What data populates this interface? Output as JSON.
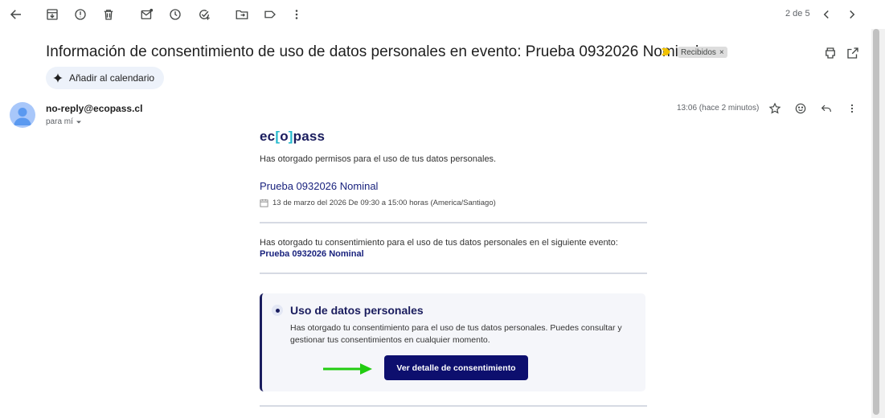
{
  "toolbar": {
    "icons": [
      "back-arrow-icon",
      "archive-icon",
      "report-spam-icon",
      "delete-icon",
      "mark-unread-icon",
      "snooze-icon",
      "add-task-icon",
      "move-to-icon",
      "label-icon",
      "more-vert-icon"
    ],
    "pager_text": "2 de 5"
  },
  "subject": "Información de consentimiento de uso de datos personales en evento: Prueba 0932026 Nominal",
  "label_chip": "Recibidos",
  "label_chip_close": "×",
  "calendar_button": "Añadir al calendario",
  "sender": {
    "email": "no-reply@ecopass.cl",
    "to": "para mí",
    "time": "13:06 (hace 2 minutos)"
  },
  "email": {
    "brand_prefix": "ec",
    "brand_open": "[",
    "brand_mid": "o",
    "brand_close": "]",
    "brand_suffix": "pass",
    "intro": "Has otorgado permisos para el uso de tus datos personales.",
    "event_name": "Prueba 0932026 Nominal",
    "event_date": "13 de marzo del 2026 De 09:30 a 15:00 horas (America/Santiago)",
    "consent_text": "Has otorgado tu consentimiento para el uso de tus datos personales en el siguiente evento:",
    "consent_event": "Prueba 0932026 Nominal",
    "card_title": "Uso de datos personales",
    "card_text": "Has otorgado tu consentimiento para el uso de tus datos personales. Puedes consultar y gestionar tus consentimientos en cualquier momento.",
    "cta_label": "Ver detalle de consentimiento"
  },
  "colors": {
    "brand_navy": "#1a1d5e",
    "brand_cyan": "#22b8cc",
    "cta_bg": "#0d0f6e",
    "arrow": "#22cc11",
    "importance_marker": "#f2c200"
  }
}
